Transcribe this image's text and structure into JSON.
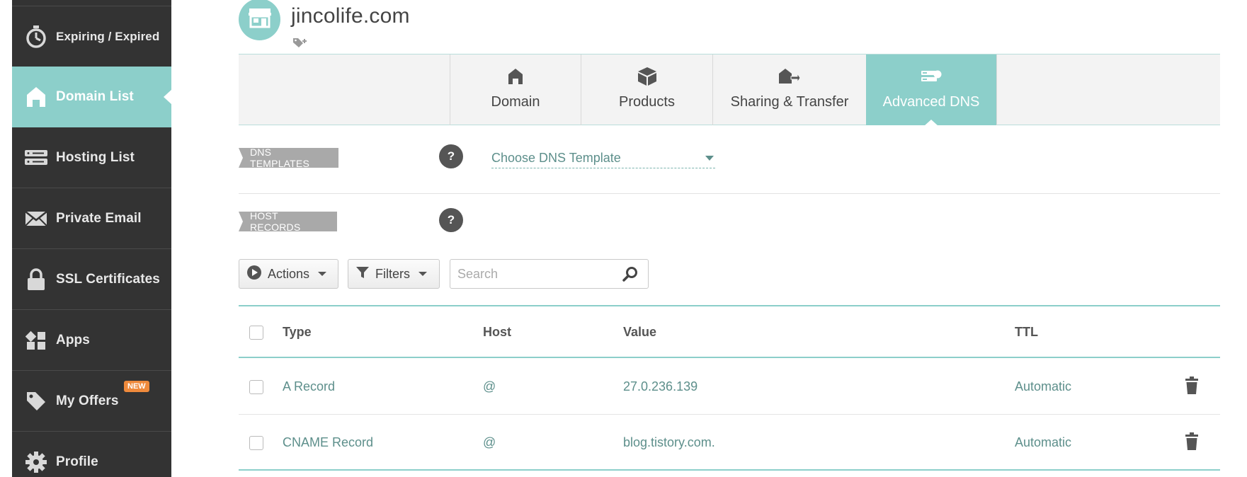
{
  "sidebar": {
    "items": [
      {
        "label": "Expiring / Expired",
        "icon": "stopwatch-icon",
        "active": false
      },
      {
        "label": "Domain List",
        "icon": "home-icon",
        "active": true
      },
      {
        "label": "Hosting List",
        "icon": "server-icon",
        "active": false
      },
      {
        "label": "Private Email",
        "icon": "envelope-icon",
        "active": false
      },
      {
        "label": "SSL Certificates",
        "icon": "lock-icon",
        "active": false
      },
      {
        "label": "Apps",
        "icon": "apps-grid-icon",
        "active": false
      },
      {
        "label": "My Offers",
        "icon": "tag-icon",
        "active": false,
        "badge": "NEW"
      },
      {
        "label": "Profile",
        "icon": "gear-icon",
        "active": false
      }
    ]
  },
  "header": {
    "domain": "jincolife.com",
    "avatar_icon": "storefront-icon",
    "tag_icon": "add-tag-icon"
  },
  "tabs": [
    {
      "label": "Domain",
      "icon": "home-icon",
      "active": false
    },
    {
      "label": "Products",
      "icon": "box-icon",
      "active": false
    },
    {
      "label": "Sharing & Transfer",
      "icon": "house-transfer-icon",
      "active": false
    },
    {
      "label": "Advanced DNS",
      "icon": "dns-server-icon",
      "active": true
    }
  ],
  "dns_templates": {
    "label": "DNS TEMPLATES",
    "help": "?",
    "select_value": "Choose DNS Template"
  },
  "host_records": {
    "label": "HOST RECORDS",
    "help": "?"
  },
  "toolbar": {
    "actions_label": "Actions",
    "filters_label": "Filters",
    "search_placeholder": "Search"
  },
  "table": {
    "columns": [
      "Type",
      "Host",
      "Value",
      "TTL"
    ],
    "rows": [
      {
        "type": "A Record",
        "host": "@",
        "value": "27.0.236.139",
        "ttl": "Automatic"
      },
      {
        "type": "CNAME Record",
        "host": "@",
        "value": "blog.tistory.com.",
        "ttl": "Automatic"
      }
    ]
  },
  "colors": {
    "accent": "#8ccfca",
    "sidebar_bg": "#333333",
    "badge": "#ef8a3c",
    "link_text": "#5d8f8b"
  }
}
